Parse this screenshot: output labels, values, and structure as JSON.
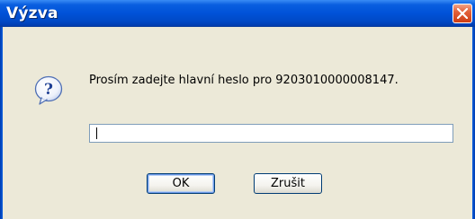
{
  "dialog": {
    "title": "Výzva",
    "message": "Prosím zadejte hlavní heslo pro 9203010000008147.",
    "password_value": "",
    "ok_label": "OK",
    "cancel_label": "Zrušit"
  },
  "icons": {
    "close": "close-icon",
    "question": "question-icon"
  },
  "colors": {
    "titlebar": "#0052d8",
    "background": "#ece9d8",
    "close_button": "#e2603a"
  }
}
